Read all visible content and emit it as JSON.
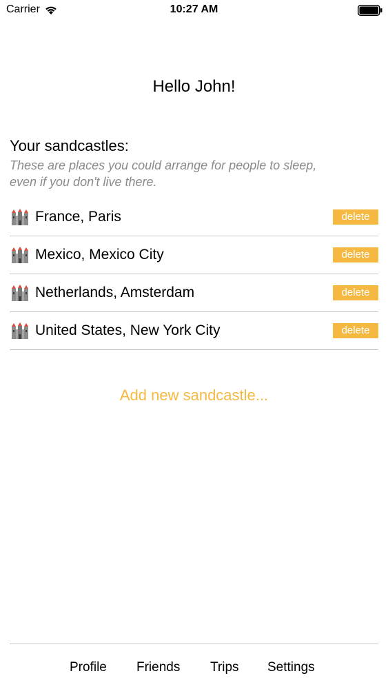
{
  "status_bar": {
    "carrier": "Carrier",
    "time": "10:27 AM"
  },
  "greeting": "Hello John!",
  "section": {
    "title": "Your sandcastles:",
    "subtitle_line1": "These are places you could arrange for people to sleep,",
    "subtitle_line2": "even if you don't live there."
  },
  "sandcastles": [
    {
      "label": "France, Paris",
      "delete_label": "delete"
    },
    {
      "label": "Mexico, Mexico City",
      "delete_label": "delete"
    },
    {
      "label": "Netherlands, Amsterdam",
      "delete_label": "delete"
    },
    {
      "label": "United States, New York City",
      "delete_label": "delete"
    }
  ],
  "add_button_label": "Add new sandcastle...",
  "tabs": [
    {
      "label": "Profile"
    },
    {
      "label": "Friends"
    },
    {
      "label": "Trips"
    },
    {
      "label": "Settings"
    }
  ],
  "colors": {
    "accent": "#f5b941",
    "subtitle": "#8a8a8e",
    "separator": "#c7c7cc"
  },
  "icons": {
    "row_icon": "castle-icon",
    "status": [
      "wifi-icon",
      "battery-icon"
    ]
  }
}
